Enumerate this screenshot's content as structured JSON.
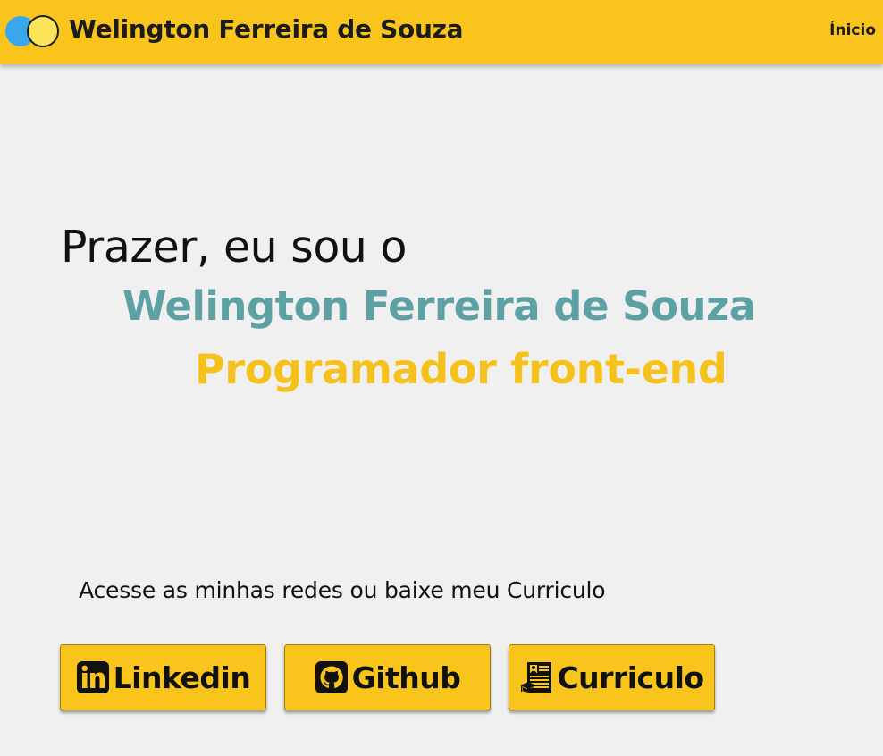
{
  "header": {
    "brand": "Welington Ferreira de Souza",
    "nav_inicio": "Ínicio"
  },
  "hero": {
    "greeting": "Prazer, eu sou o",
    "name": "Welington Ferreira de Souza",
    "role": "Programador front-end"
  },
  "links": {
    "cta": "Acesse as minhas redes ou baixe meu Curriculo",
    "buttons": [
      {
        "label": "Linkedin",
        "icon": "linkedin-icon"
      },
      {
        "label": "Github",
        "icon": "github-icon"
      },
      {
        "label": "Curriculo",
        "icon": "resume-icon"
      }
    ]
  },
  "colors": {
    "header_bg": "#f9c51d",
    "name": "#5ea1a4",
    "role": "#f5c21d",
    "page_bg": "#f0f0f0"
  }
}
